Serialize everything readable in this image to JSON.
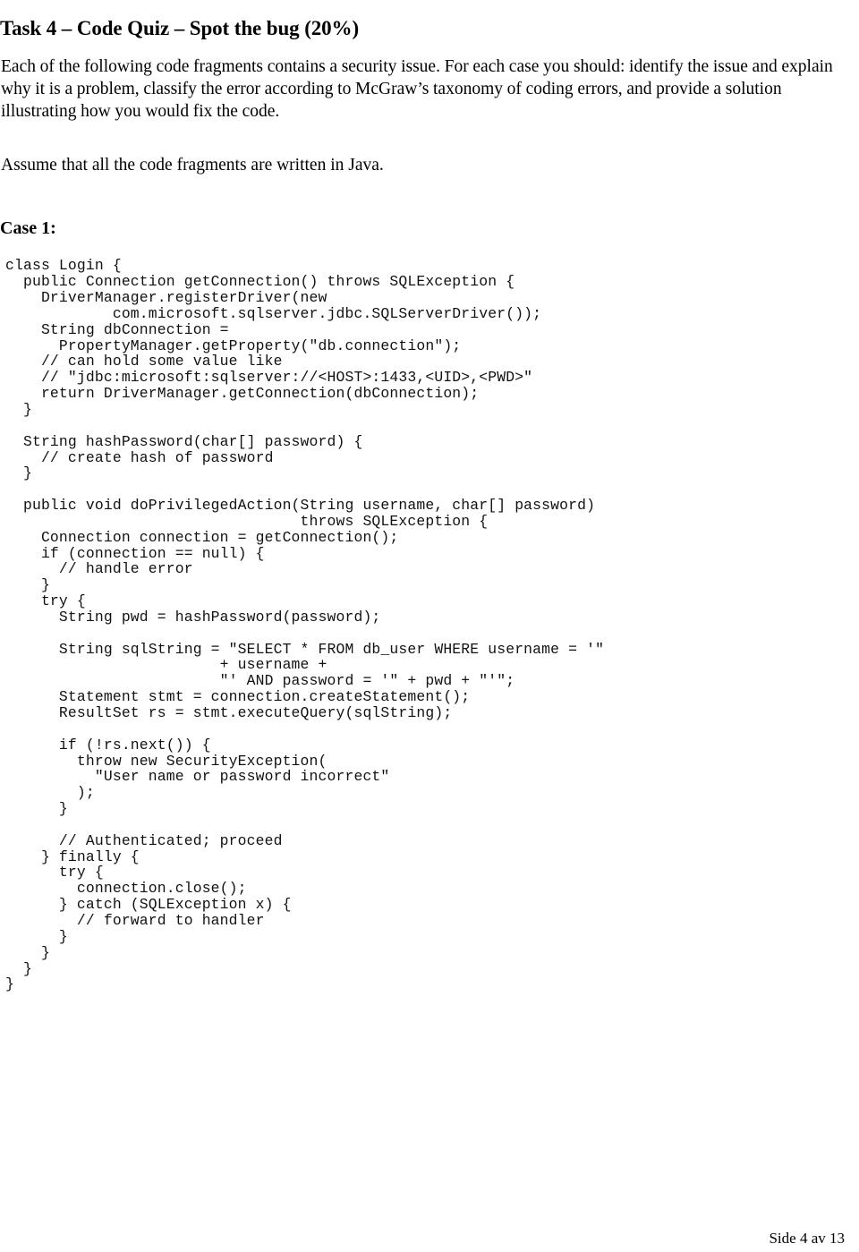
{
  "heading": {
    "text": "Task 4 – Code Quiz – Spot the bug (20%)"
  },
  "intro": {
    "paragraph": "Each of the following code fragments contains a security issue. For each case you should: identify the issue and explain why it is a problem, classify the error according to McGraw’s taxonomy of coding errors, and provide a solution illustrating how you would fix the code."
  },
  "assume": {
    "text": "Assume that all the code fragments are written in Java."
  },
  "case": {
    "label": "Case 1:"
  },
  "code": {
    "language": "Java",
    "lines": [
      "class Login {",
      "  public Connection getConnection() throws SQLException {",
      "    DriverManager.registerDriver(new",
      "            com.microsoft.sqlserver.jdbc.SQLServerDriver());",
      "    String dbConnection =",
      "      PropertyManager.getProperty(\"db.connection\");",
      "    // can hold some value like",
      "    // \"jdbc:microsoft:sqlserver://<HOST>:1433,<UID>,<PWD>\"",
      "    return DriverManager.getConnection(dbConnection);",
      "  }",
      "",
      "  String hashPassword(char[] password) {",
      "    // create hash of password",
      "  }",
      "",
      "  public void doPrivilegedAction(String username, char[] password)",
      "                                 throws SQLException {",
      "    Connection connection = getConnection();",
      "    if (connection == null) {",
      "      // handle error",
      "    }",
      "    try {",
      "      String pwd = hashPassword(password);",
      "",
      "      String sqlString = \"SELECT * FROM db_user WHERE username = '\"",
      "                        + username +",
      "                        \"' AND password = '\" + pwd + \"'\";",
      "      Statement stmt = connection.createStatement();",
      "      ResultSet rs = stmt.executeQuery(sqlString);",
      "",
      "      if (!rs.next()) {",
      "        throw new SecurityException(",
      "          \"User name or password incorrect\"",
      "        );",
      "      }",
      "",
      "      // Authenticated; proceed",
      "    } finally {",
      "      try {",
      "        connection.close();",
      "      } catch (SQLException x) {",
      "        // forward to handler",
      "      }",
      "    }",
      "  }",
      "}"
    ]
  },
  "footer": {
    "text": "Side 4 av 13"
  }
}
